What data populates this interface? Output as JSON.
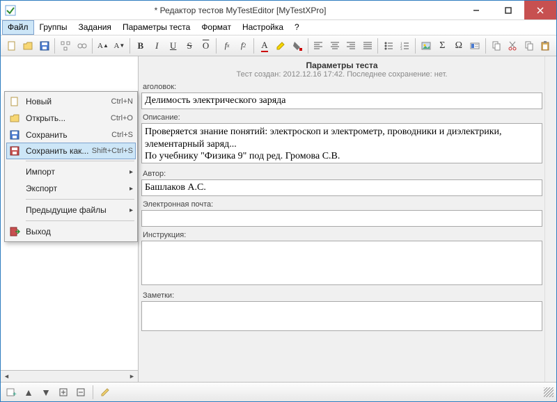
{
  "title": "* Редактор тестов MyTestEditor [MyTestXPro]",
  "menubar": [
    "Файл",
    "Группы",
    "Задания",
    "Параметры теста",
    "Формат",
    "Настройка",
    "?"
  ],
  "file_menu": {
    "new": {
      "label": "Новый",
      "shortcut": "Ctrl+N"
    },
    "open": {
      "label": "Открыть...",
      "shortcut": "Ctrl+O"
    },
    "save": {
      "label": "Сохранить",
      "shortcut": "Ctrl+S"
    },
    "saveas": {
      "label": "Сохранить как...",
      "shortcut": "Shift+Ctrl+S"
    },
    "import": {
      "label": "Импорт"
    },
    "export": {
      "label": "Экспорт"
    },
    "recent": {
      "label": "Предыдущие файлы"
    },
    "exit": {
      "label": "Выход"
    }
  },
  "params": {
    "header": "Параметры теста",
    "subheader": "Тест создан: 2012.12.16 17:42. Последнее сохранение: нет.",
    "title_label": "аголовок:",
    "title_value": "Делимость электрического заряда",
    "desc_label": "Описание:",
    "desc_value": "Проверяется знание понятий: электроскоп и электрометр, проводники и диэлектрики, элементарный заряд...\nПо учебнику \"Физика 9\" под ред. Громова С.В.",
    "author_label": "Автор:",
    "author_value": "Башлаков А.С.",
    "email_label": "Электронная почта:",
    "email_value": "",
    "instr_label": "Инструкция:",
    "instr_value": "",
    "notes_label": "Заметки:",
    "notes_value": ""
  }
}
